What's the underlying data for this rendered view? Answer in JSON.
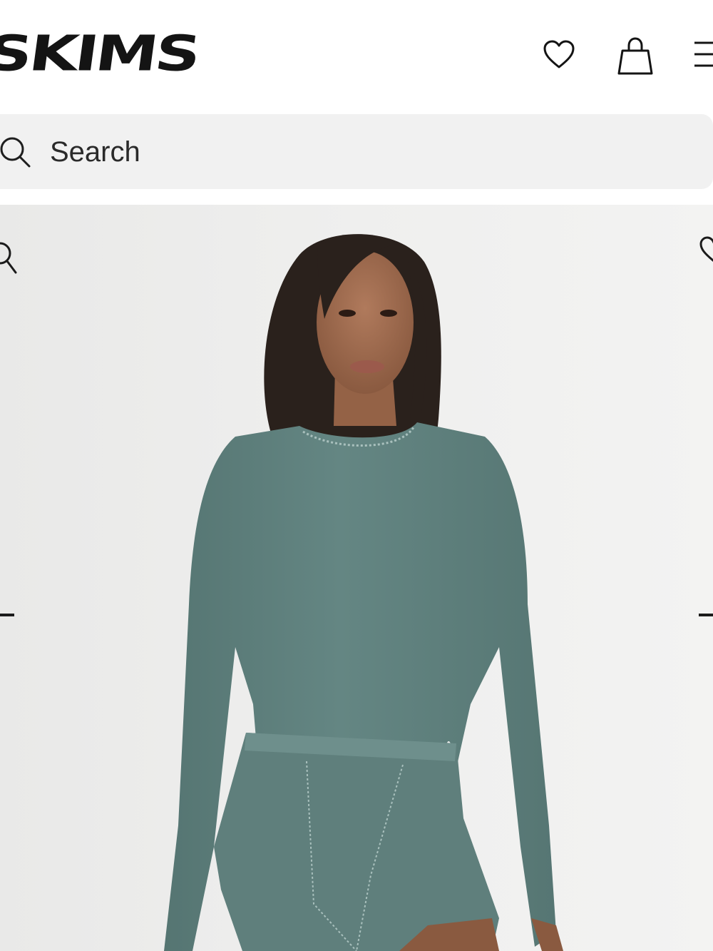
{
  "header": {
    "brand": "SKIMS",
    "icons": {
      "wishlist": "heart-icon",
      "bag": "shopping-bag-icon",
      "menu": "hamburger-menu-icon"
    }
  },
  "search": {
    "placeholder": "Search",
    "icon": "search-icon"
  },
  "product_image": {
    "icons": {
      "zoom": "zoom-icon",
      "wishlist": "heart-icon",
      "prev": "previous-arrow-icon",
      "next": "next-arrow-icon"
    }
  },
  "colors": {
    "text": "#141414",
    "search_bg": "#f1f1f1",
    "hero_bg": "#ececeb",
    "garment": "#5e807d"
  }
}
